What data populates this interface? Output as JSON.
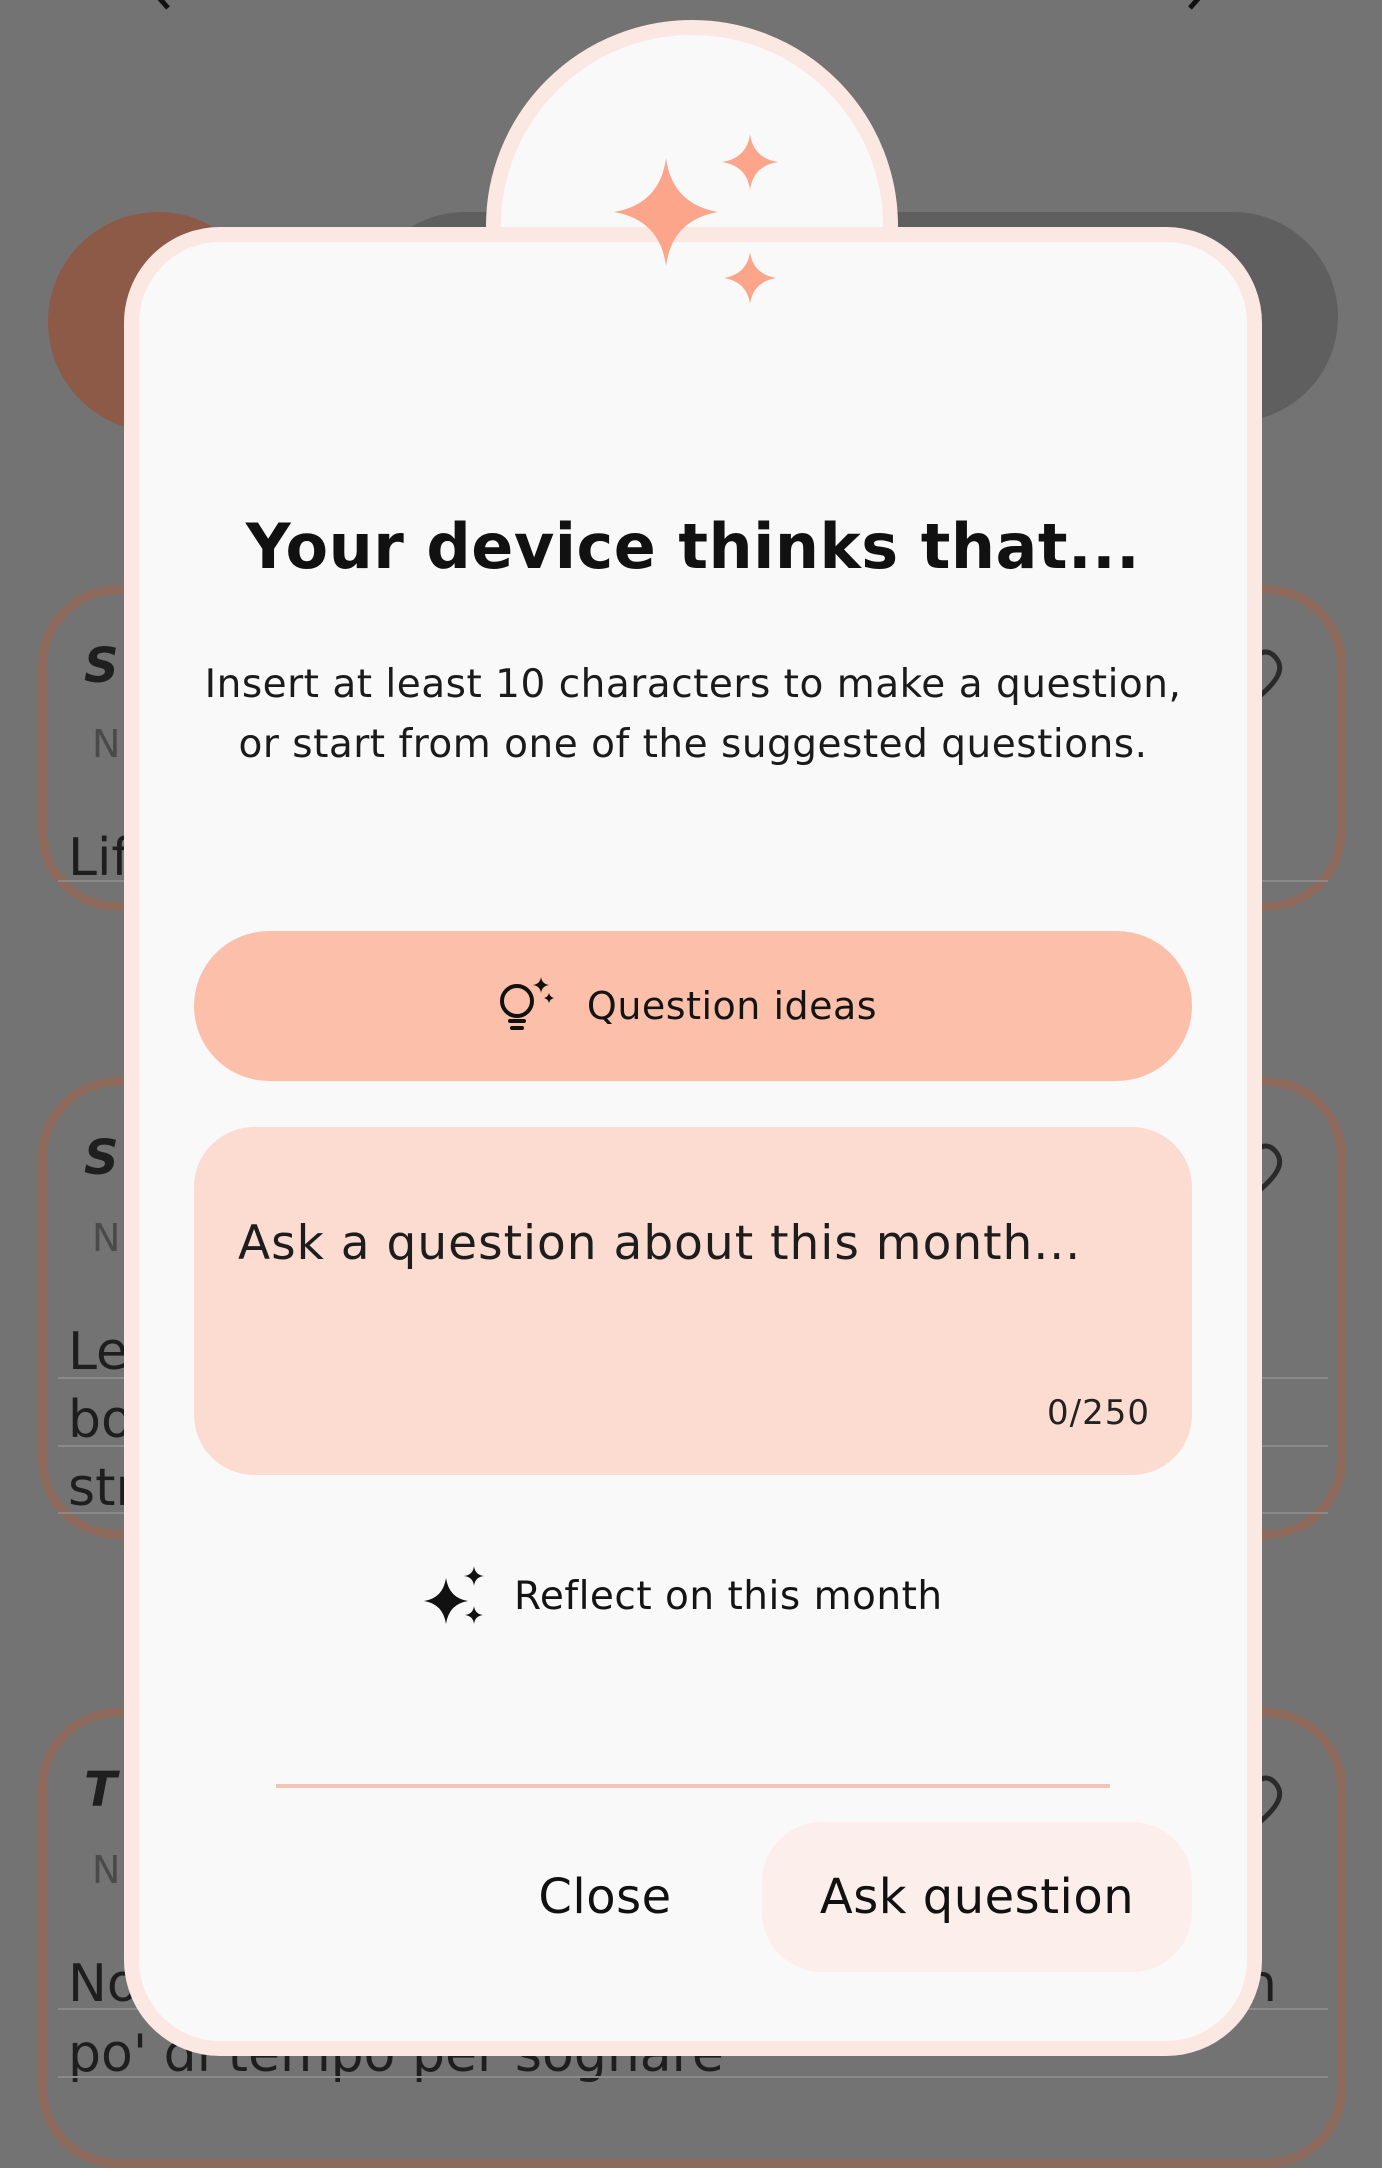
{
  "background": {
    "cards": [
      {
        "title": "S",
        "subtitle": "N",
        "body_lines": [
          "Lif"
        ]
      },
      {
        "title": "S",
        "subtitle": "N",
        "body_lines": [
          "Le",
          "bo",
          "str"
        ]
      },
      {
        "title": "T",
        "subtitle": "N",
        "body_lines": [
          "No",
          "po' di tempo per sognare"
        ],
        "tail": "n"
      }
    ]
  },
  "dialog": {
    "title": "Your device thinks that...",
    "description": "Insert at least 10 characters to make a question, or start from one of the suggested questions.",
    "question_ideas_label": "Question ideas",
    "question_input": {
      "placeholder": "Ask a question about this month...",
      "value": "",
      "counter": "0/250"
    },
    "reflect_label": "Reflect on this month",
    "close_label": "Close",
    "ask_label": "Ask question"
  },
  "colors": {
    "accent": "#fcc0aa",
    "input_bg": "#fcdcd1",
    "sparkle": "#fca58a",
    "sheet_border": "#fce8e3"
  },
  "icons": {
    "hero": "sparkles-icon",
    "ideas": "lightbulb-sparkle-icon",
    "reflect": "sparkles-icon",
    "nav_prev": "chevron-left-icon",
    "nav_next": "chevron-right-icon",
    "card_action": "heart-icon"
  }
}
